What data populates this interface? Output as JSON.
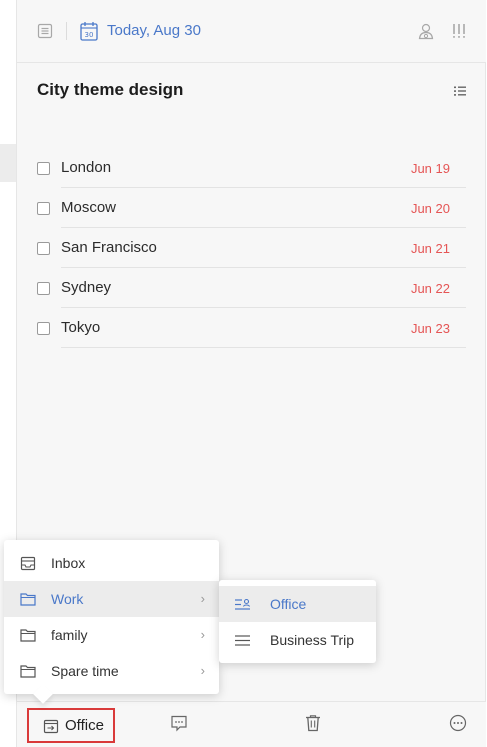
{
  "header": {
    "date_label": "Today, Aug 30",
    "calendar_day": "30"
  },
  "task_title": "City theme design",
  "tasks": [
    {
      "name": "London",
      "due": "Jun 19"
    },
    {
      "name": "Moscow",
      "due": "Jun 20"
    },
    {
      "name": "San Francisco",
      "due": "Jun 21"
    },
    {
      "name": "Sydney",
      "due": "Jun 22"
    },
    {
      "name": "Tokyo",
      "due": "Jun 23"
    }
  ],
  "move_menu": {
    "items": [
      {
        "label": "Inbox",
        "icon": "inbox-icon",
        "has_submenu": false
      },
      {
        "label": "Work",
        "icon": "folder-icon",
        "has_submenu": true,
        "active": true
      },
      {
        "label": "family",
        "icon": "folder-icon",
        "has_submenu": true
      },
      {
        "label": "Spare time",
        "icon": "folder-icon",
        "has_submenu": true
      }
    ]
  },
  "submenu": {
    "items": [
      {
        "label": "Office",
        "icon": "list-icon",
        "active": true
      },
      {
        "label": "Business Trip",
        "icon": "list-lines-icon"
      }
    ]
  },
  "footer": {
    "current_list": "Office"
  },
  "colors": {
    "accent": "#4a78c9",
    "due_date": "#e55555",
    "highlight_border": "#d93a3a"
  }
}
